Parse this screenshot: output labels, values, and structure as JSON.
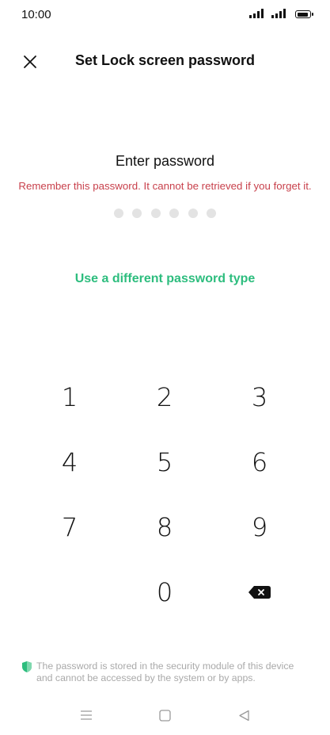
{
  "status_bar": {
    "time": "10:00",
    "icons": [
      "signal-icon",
      "signal-icon",
      "battery-icon"
    ]
  },
  "header": {
    "title": "Set Lock screen password",
    "close_icon": "close-icon"
  },
  "password_entry": {
    "label": "Enter password",
    "warning": "Remember this password. It cannot be retrieved if you forget it.",
    "dot_count": 6,
    "alt_type_link": "Use a different password type"
  },
  "keypad": {
    "keys": [
      "1",
      "2",
      "3",
      "4",
      "5",
      "6",
      "7",
      "8",
      "9",
      "0"
    ],
    "delete_icon": "backspace-icon"
  },
  "footer": {
    "note_line1": "The password is stored in the security module of this device",
    "note_line2": "and cannot be accessed by the system or by apps.",
    "icon": "shield-icon"
  },
  "nav_bar": {
    "buttons": [
      "menu-icon",
      "home-icon",
      "back-icon"
    ]
  },
  "colors": {
    "accent": "#2dbd7e",
    "warning": "#c8414c",
    "dots": "#e3e3e3",
    "footer_text": "#a9a9a9"
  }
}
